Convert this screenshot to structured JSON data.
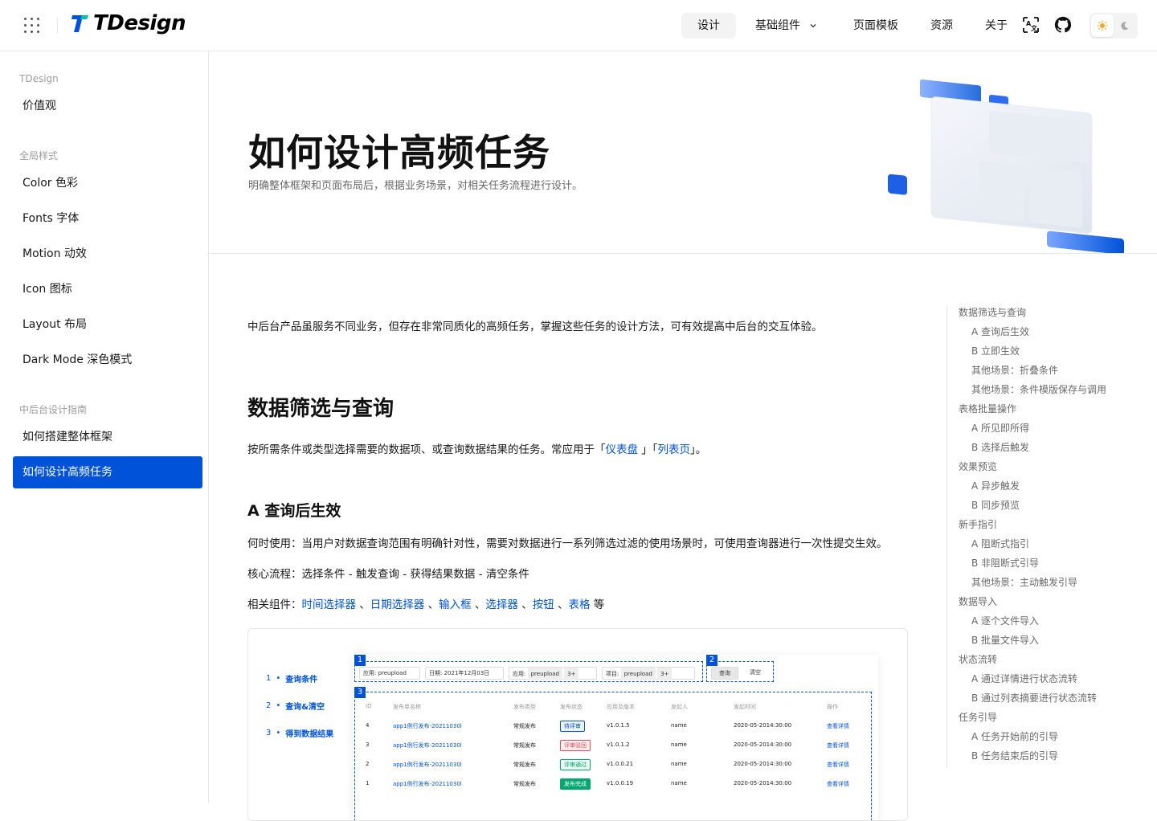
{
  "header": {
    "logo_text": "TDesign",
    "nav": [
      {
        "label": "设计",
        "active": true
      },
      {
        "label": "基础组件",
        "dropdown": true
      },
      {
        "label": "页面模板"
      },
      {
        "label": "资源"
      },
      {
        "label": "关于"
      }
    ]
  },
  "sidebar": {
    "groups": [
      {
        "title": "TDesign",
        "items": [
          "价值观"
        ]
      },
      {
        "title": "全局样式",
        "items": [
          "Color 色彩",
          "Fonts 字体",
          "Motion 动效",
          "Icon 图标",
          "Layout 布局",
          "Dark Mode 深色模式"
        ]
      },
      {
        "title": "中后台设计指南",
        "items": [
          "如何搭建整体框架",
          "如何设计高频任务"
        ]
      }
    ],
    "active_item": "如何设计高频任务"
  },
  "hero": {
    "title": "如何设计高频任务",
    "subtitle": "明确整体框架和页面布局后，根据业务场景，对相关任务流程进行设计。"
  },
  "content": {
    "intro": "中后台产品虽服务不同业务，但存在非常同质化的高频任务，掌握这些任务的设计方法，可有效提高中后台的交互体验。",
    "h2": "数据筛选与查询",
    "p_desc_prefix": "按所需条件或类型选择需要的数据项、或查询数据结果的任务。常应用于「",
    "p_link1": "仪表盘",
    "p_mid": " 」「",
    "p_link2": "列表页",
    "p_suffix": "」。",
    "h3": "A 查询后生效",
    "when": "何时使用：当用户对数据查询范围有明确针对性，需要对数据进行一系列筛选过滤的使用场景时，可使用查询器进行一次性提交生效。",
    "flow": "核心流程：选择条件 - 触发查询 - 获得结果数据 - 清空条件",
    "related_prefix": "相关组件：",
    "related": [
      "时间选择器",
      "日期选择器",
      "输入框",
      "选择器",
      "按钮",
      "表格"
    ],
    "related_suffix": " 等",
    "demo": {
      "steps": [
        {
          "n": "1",
          "label": "查询条件"
        },
        {
          "n": "2",
          "label": "查询&清空"
        },
        {
          "n": "3",
          "label": "得到数据结果"
        }
      ],
      "box_numbers": [
        "1",
        "2",
        "3"
      ],
      "filters": {
        "app_label": "应用: preupload",
        "date_label": "日期: 2021年12月03日",
        "app2_label": "应用:",
        "app2_tag": "preupload",
        "app2_more": "3+",
        "proj_label": "项目:",
        "proj_tag": "preupload",
        "proj_more": "3+",
        "query_btn": "查询",
        "clear_btn": "清空"
      },
      "columns": [
        "ID",
        "发布单名称",
        "发布类型",
        "发布状态",
        "应用及版本",
        "发起人",
        "发起时间",
        "操作"
      ],
      "rows": [
        {
          "id": "4",
          "name": "app1例行发布-20211030l",
          "type": "常规发布",
          "status": "待评审",
          "status_color": "#0052d9",
          "status_bg": "#ecf2fe",
          "ver": "v1.0.1.5",
          "user": "name",
          "time": "2020-05-2014:30:00",
          "op": "查看详情"
        },
        {
          "id": "3",
          "name": "app1例行发布-20211030l",
          "type": "常规发布",
          "status": "评审驳回",
          "status_color": "#e34d59",
          "status_bg": "#fdecee",
          "ver": "v1.0.1.2",
          "user": "name",
          "time": "2020-05-2014:30:00",
          "op": "查看详情"
        },
        {
          "id": "2",
          "name": "app1例行发布-20211030l",
          "type": "常规发布",
          "status": "评审通过",
          "status_color": "#00a870",
          "status_bg": "#e8f8f2",
          "ver": "v1.0.0.21",
          "user": "name",
          "time": "2020-05-2014:30:00",
          "op": "查看详情"
        },
        {
          "id": "1",
          "name": "app1例行发布-20211030l",
          "type": "常规发布",
          "status": "发布完成",
          "status_color": "#ffffff",
          "status_bg": "#00a870",
          "ver": "v1.0.0.19",
          "user": "name",
          "time": "2020-05-2014:30:00",
          "op": "查看详情"
        }
      ]
    }
  },
  "toc": [
    {
      "label": "数据筛选与查询",
      "level": 1
    },
    {
      "label": "A 查询后生效",
      "level": 2
    },
    {
      "label": "B 立即生效",
      "level": 2
    },
    {
      "label": "其他场景：折叠条件",
      "level": 2
    },
    {
      "label": "其他场景：条件模版保存与调用",
      "level": 2
    },
    {
      "label": "表格批量操作",
      "level": 1
    },
    {
      "label": "A 所见即所得",
      "level": 2
    },
    {
      "label": "B 选择后触发",
      "level": 2
    },
    {
      "label": "效果预览",
      "level": 1
    },
    {
      "label": "A 异步触发",
      "level": 2
    },
    {
      "label": "B 同步预览",
      "level": 2
    },
    {
      "label": "新手指引",
      "level": 1
    },
    {
      "label": "A 阻断式指引",
      "level": 2
    },
    {
      "label": "B 非阻断式引导",
      "level": 2
    },
    {
      "label": "其他场景：主动触发引导",
      "level": 2
    },
    {
      "label": "数据导入",
      "level": 1
    },
    {
      "label": "A 逐个文件导入",
      "level": 2
    },
    {
      "label": "B 批量文件导入",
      "level": 2
    },
    {
      "label": "状态流转",
      "level": 1
    },
    {
      "label": "A 通过详情进行状态流转",
      "level": 2
    },
    {
      "label": "B 通过列表摘要进行状态流转",
      "level": 2
    },
    {
      "label": "任务引导",
      "level": 1
    },
    {
      "label": "A 任务开始前的引导",
      "level": 2
    },
    {
      "label": "B 任务结束后的引导",
      "level": 2
    }
  ],
  "colors": {
    "brand": "#0052d9",
    "border": "#e7e7e7"
  },
  "icons": [
    "grid-icon",
    "tdesign-logo-icon",
    "chevron-down-icon",
    "translate-icon",
    "github-icon",
    "sun-icon",
    "moon-icon"
  ]
}
